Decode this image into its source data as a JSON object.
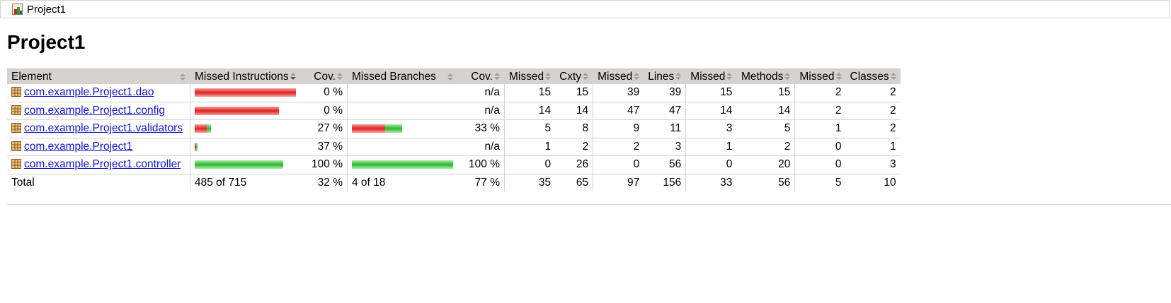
{
  "breadcrumb": {
    "icon": "report-icon",
    "label": "Project1"
  },
  "title": "Project1",
  "table": {
    "headers": {
      "element": "Element",
      "missed_instructions": "Missed Instructions",
      "cov_instructions": "Cov.",
      "missed_branches": "Missed Branches",
      "cov_branches": "Cov.",
      "missed_cxty": "Missed",
      "cxty": "Cxty",
      "missed_lines": "Missed",
      "lines": "Lines",
      "missed_methods": "Missed",
      "methods": "Methods",
      "missed_classes": "Missed",
      "classes": "Classes"
    },
    "rows": [
      {
        "name": "com.example.Project1.dao",
        "instr_bar": {
          "missed": 1.0,
          "covered": 0.0
        },
        "instr_cov": "0 %",
        "branch_bar": null,
        "branch_cov": "n/a",
        "missed_cxty": "15",
        "cxty": "15",
        "missed_lines": "39",
        "lines": "39",
        "missed_methods": "15",
        "methods": "15",
        "missed_classes": "2",
        "classes": "2"
      },
      {
        "name": "com.example.Project1.config",
        "instr_bar": {
          "missed": 0.83,
          "covered": 0.0
        },
        "instr_cov": "0 %",
        "branch_bar": null,
        "branch_cov": "n/a",
        "missed_cxty": "14",
        "cxty": "14",
        "missed_lines": "47",
        "lines": "47",
        "missed_methods": "14",
        "methods": "14",
        "missed_classes": "2",
        "classes": "2"
      },
      {
        "name": "com.example.Project1.validators",
        "instr_bar": {
          "missed": 0.12,
          "covered": 0.045
        },
        "instr_cov": "27 %",
        "branch_bar": {
          "missed": 0.33,
          "covered": 0.17
        },
        "branch_cov": "33 %",
        "missed_cxty": "5",
        "cxty": "8",
        "missed_lines": "9",
        "lines": "11",
        "missed_methods": "3",
        "methods": "5",
        "missed_classes": "1",
        "classes": "2"
      },
      {
        "name": "com.example.Project1",
        "instr_bar": {
          "missed": 0.014,
          "covered": 0.008
        },
        "instr_cov": "37 %",
        "branch_bar": null,
        "branch_cov": "n/a",
        "missed_cxty": "1",
        "cxty": "2",
        "missed_lines": "2",
        "lines": "3",
        "missed_methods": "1",
        "methods": "2",
        "missed_classes": "0",
        "classes": "1"
      },
      {
        "name": "com.example.Project1.controller",
        "instr_bar": {
          "missed": 0.0,
          "covered": 0.875
        },
        "instr_cov": "100 %",
        "branch_bar": {
          "missed": 0.0,
          "covered": 1.0
        },
        "branch_cov": "100 %",
        "missed_cxty": "0",
        "cxty": "26",
        "missed_lines": "0",
        "lines": "56",
        "missed_methods": "0",
        "methods": "20",
        "missed_classes": "0",
        "classes": "3"
      }
    ],
    "total": {
      "label": "Total",
      "missed_instructions": "485 of 715",
      "instr_cov": "32 %",
      "missed_branches": "4 of 18",
      "branch_cov": "77 %",
      "missed_cxty": "35",
      "cxty": "65",
      "missed_lines": "97",
      "lines": "156",
      "missed_methods": "33",
      "methods": "56",
      "missed_classes": "5",
      "classes": "10"
    }
  },
  "colors": {
    "missed": "#e02020",
    "covered": "#2cb82c",
    "header_bg": "#d6d3ce",
    "link": "#1414c8"
  }
}
